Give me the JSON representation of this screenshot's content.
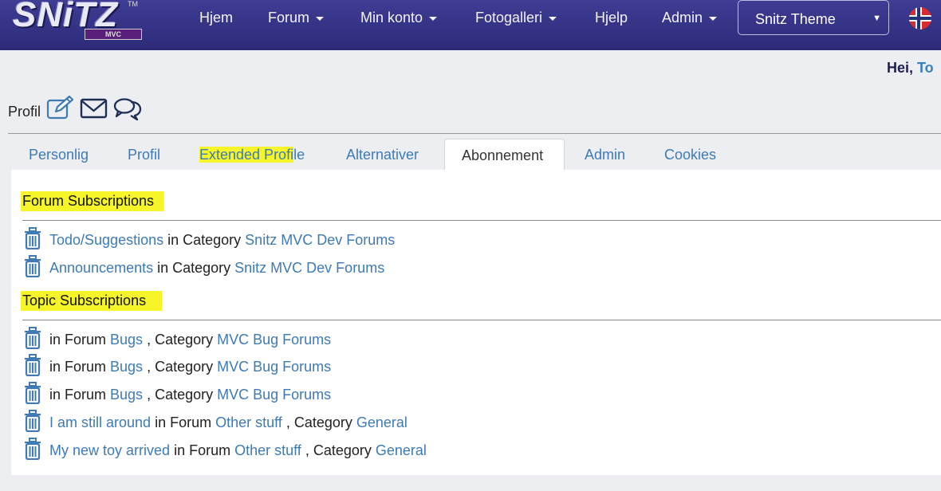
{
  "brand": {
    "logo_text": "SNiTZ",
    "logo_sub": "MVC",
    "tm": "TM"
  },
  "nav": {
    "items": [
      {
        "label": "Hjem",
        "dropdown": false
      },
      {
        "label": "Forum",
        "dropdown": true
      },
      {
        "label": "Min konto",
        "dropdown": true
      },
      {
        "label": "Fotogalleri",
        "dropdown": true
      },
      {
        "label": "Hjelp",
        "dropdown": false
      },
      {
        "label": "Admin",
        "dropdown": true
      }
    ],
    "theme_select": {
      "value": "Snitz Theme",
      "arrow": "▼"
    },
    "language_icon": "norway-flag-icon"
  },
  "greeting": {
    "prefix": "Hei, ",
    "user": "To"
  },
  "profile": {
    "label": "Profil",
    "icons": [
      "edit-icon",
      "envelope-icon",
      "chat-icon"
    ]
  },
  "tabs": [
    {
      "label": "Personlig",
      "active": false,
      "highlighted": false
    },
    {
      "label": "Profil",
      "active": false,
      "highlighted": false
    },
    {
      "label_highlighted": "Extended Profi",
      "label_rest": "le",
      "active": false,
      "highlighted": true
    },
    {
      "label": "Alternativer",
      "active": false,
      "highlighted": false
    },
    {
      "label": "Abonnement",
      "active": true,
      "highlighted": false
    },
    {
      "label": "Admin",
      "active": false,
      "highlighted": false
    },
    {
      "label": "Cookies",
      "active": false,
      "highlighted": false
    }
  ],
  "forum_subscriptions": {
    "title": "Forum Subscriptions",
    "rows": [
      {
        "forum": "Todo/Suggestions",
        "in_text": " in Category ",
        "category": "Snitz MVC Dev Forums"
      },
      {
        "forum": "Announcements",
        "in_text": " in Category ",
        "category": "Snitz MVC Dev Forums"
      }
    ]
  },
  "topic_subscriptions": {
    "title": "Topic Subscriptions",
    "rows": [
      {
        "topic": "",
        "in_forum": "in Forum ",
        "forum": "Bugs",
        "in_category": " , Category ",
        "category": "MVC Bug Forums"
      },
      {
        "topic": "",
        "in_forum": "in Forum ",
        "forum": "Bugs",
        "in_category": " , Category ",
        "category": "MVC Bug Forums"
      },
      {
        "topic": "",
        "in_forum": "in Forum ",
        "forum": "Bugs",
        "in_category": " , Category ",
        "category": "MVC Bug Forums"
      },
      {
        "topic": "I am still around",
        "in_forum": " in Forum ",
        "forum": "Other stuff",
        "in_category": " , Category ",
        "category": "General"
      },
      {
        "topic": "My new toy arrived",
        "in_forum": " in Forum ",
        "forum": "Other stuff",
        "in_category": " , Category ",
        "category": "General"
      }
    ]
  },
  "colors": {
    "navbar": "#3f3d94",
    "link": "#3f7ab5",
    "highlight": "#f6f52a",
    "background": "#eceef2"
  }
}
